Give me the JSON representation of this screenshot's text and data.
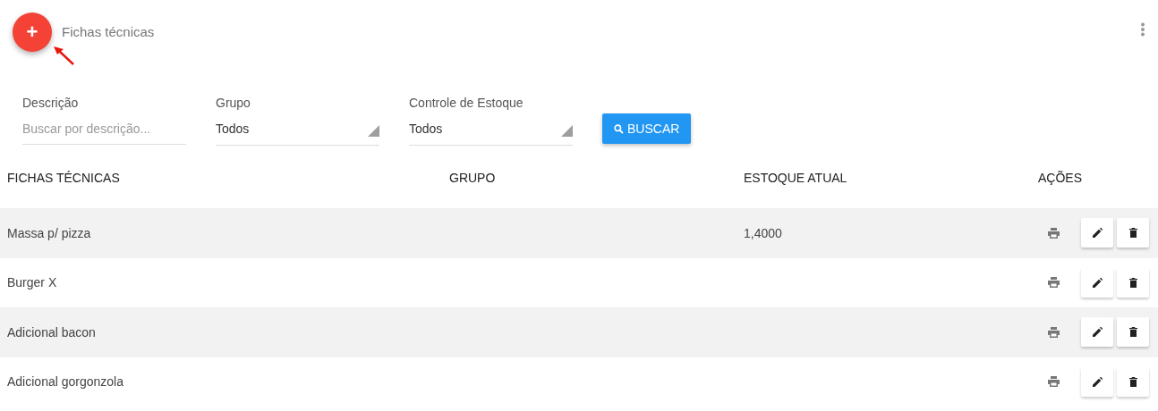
{
  "header": {
    "add_button": "+",
    "title": "Fichas técnicas"
  },
  "filters": [
    {
      "kind": "text",
      "label": "Descrição",
      "placeholder": "Buscar por descrição..."
    },
    {
      "kind": "select",
      "label": "Grupo",
      "value": "Todos"
    },
    {
      "kind": "select",
      "label": "Controle de Estoque",
      "value": "Todos"
    }
  ],
  "search_button": "BUSCAR",
  "table": {
    "columns": [
      "FICHAS TÉCNICAS",
      "GRUPO",
      "ESTOQUE ATUAL",
      "AÇÕES"
    ],
    "rows": [
      {
        "name": "Massa p/ pizza",
        "stock": "1,4000"
      },
      {
        "name": "Burger X"
      },
      {
        "name": "Adicional bacon"
      },
      {
        "name": "Adicional gorgonzola"
      }
    ]
  }
}
